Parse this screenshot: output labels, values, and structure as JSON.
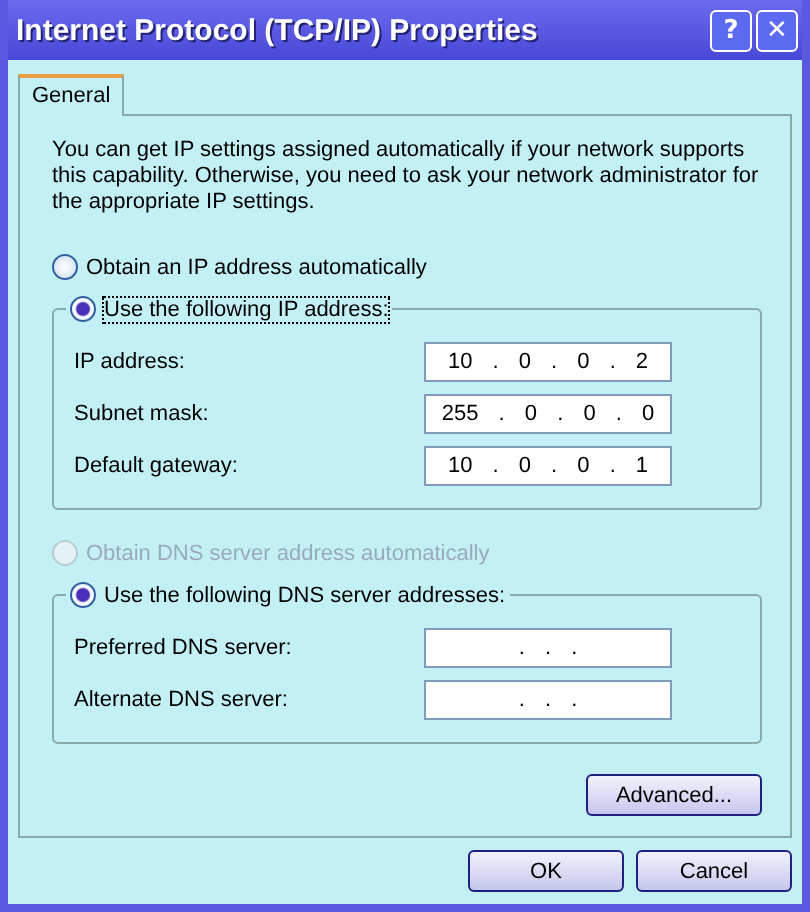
{
  "window": {
    "title": "Internet Protocol (TCP/IP) Properties",
    "title_buttons": [
      "?",
      "✕"
    ]
  },
  "tabs": [
    {
      "label": "General",
      "selected": true
    }
  ],
  "intro": "You can get IP settings assigned automatically if your network supports this capability. Otherwise, you need to ask your network administrator for the appropriate IP settings.",
  "ip_auto": {
    "label": "Obtain an IP address automatically",
    "selected": false,
    "disabled": false
  },
  "ip_manual": {
    "label": "Use the following IP address:",
    "selected": true,
    "disabled": false,
    "focused": true,
    "fields": [
      {
        "label": "IP address:",
        "value": "10 . 0 . 0 . 2"
      },
      {
        "label": "Subnet mask:",
        "value": "255 . 0 . 0 . 0"
      },
      {
        "label": "Default gateway:",
        "value": "10 . 0 . 0 . 1"
      }
    ]
  },
  "dns_auto": {
    "label": "Obtain DNS server address automatically",
    "selected": false,
    "disabled": true
  },
  "dns_manual": {
    "label": "Use the following DNS server addresses:",
    "selected": true,
    "disabled": false,
    "focused": false,
    "fields": [
      {
        "label": "Preferred DNS server:",
        "value": ". . ."
      },
      {
        "label": "Alternate DNS server:",
        "value": ". . ."
      }
    ]
  },
  "advanced_button": "Advanced...",
  "buttons": [
    "OK",
    "Cancel"
  ]
}
